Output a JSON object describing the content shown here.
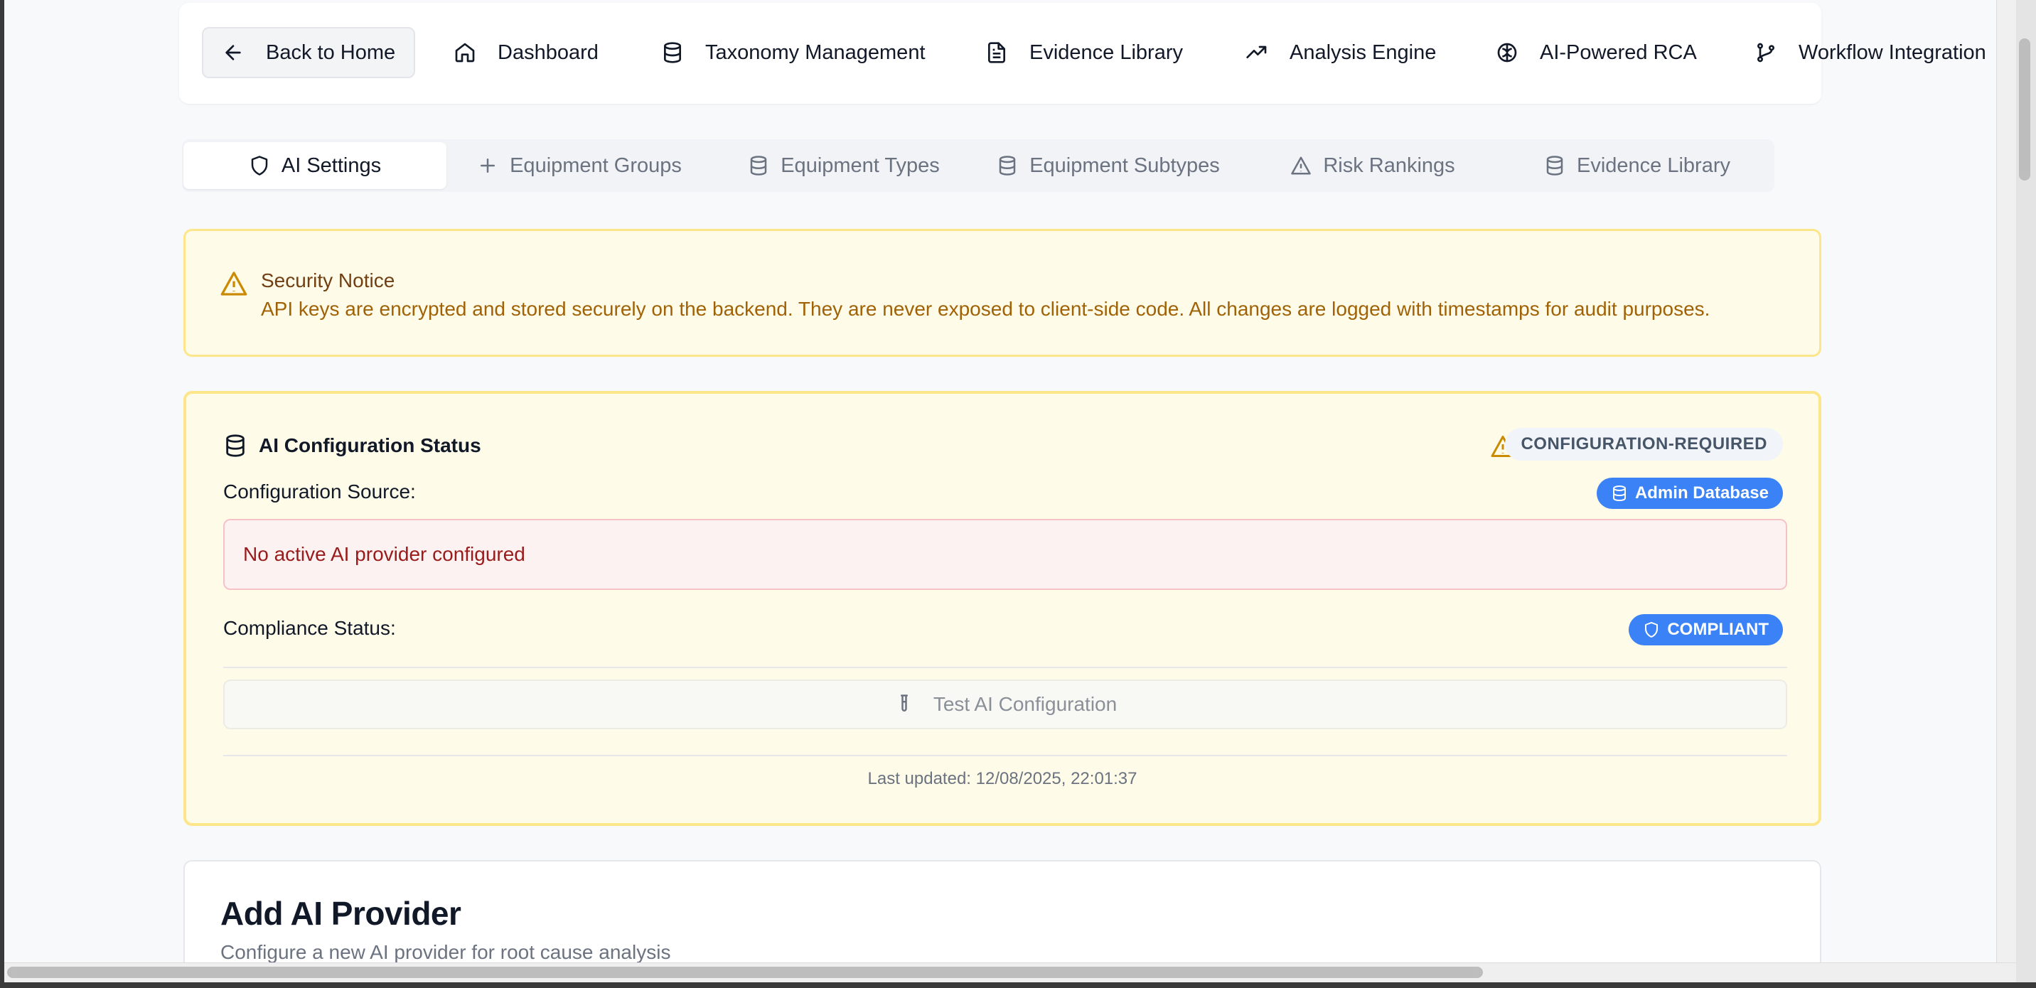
{
  "topnav": {
    "back_label": "Back to Home",
    "items": [
      {
        "label": "Dashboard",
        "icon": "home-icon"
      },
      {
        "label": "Taxonomy Management",
        "icon": "database-icon"
      },
      {
        "label": "Evidence Library",
        "icon": "file-text-icon"
      },
      {
        "label": "Analysis Engine",
        "icon": "trending-up-icon"
      },
      {
        "label": "AI-Powered RCA",
        "icon": "brain-icon"
      },
      {
        "label": "Workflow Integration",
        "icon": "git-branch-icon"
      }
    ]
  },
  "tabs": [
    {
      "label": "AI Settings",
      "icon": "shield-icon",
      "active": true
    },
    {
      "label": "Equipment Groups",
      "icon": "plus-icon",
      "active": false
    },
    {
      "label": "Equipment Types",
      "icon": "database-icon",
      "active": false
    },
    {
      "label": "Equipment Subtypes",
      "icon": "database-icon",
      "active": false
    },
    {
      "label": "Risk Rankings",
      "icon": "alert-triangle-icon",
      "active": false
    },
    {
      "label": "Evidence Library",
      "icon": "database-icon",
      "active": false
    }
  ],
  "security_notice": {
    "title": "Security Notice",
    "body": "API keys are encrypted and stored securely on the backend. They are never exposed to client-side code. All changes are logged with timestamps for audit purposes."
  },
  "status": {
    "title": "AI Configuration Status",
    "state_badge": "CONFIGURATION-REQUIRED",
    "source_label": "Configuration Source:",
    "source_badge": "Admin Database",
    "error_message": "No active AI provider configured",
    "compliance_label": "Compliance Status:",
    "compliance_badge": "COMPLIANT",
    "test_button": "Test AI Configuration",
    "last_updated": "Last updated: 12/08/2025, 22:01:37"
  },
  "add_provider": {
    "title": "Add AI Provider",
    "subtitle": "Configure a new AI provider for root cause analysis"
  },
  "colors": {
    "accent_blue": "#3b82f6",
    "warning_bg": "#fefce8",
    "warning_border": "#fde68a",
    "error_text": "#991b1b"
  }
}
